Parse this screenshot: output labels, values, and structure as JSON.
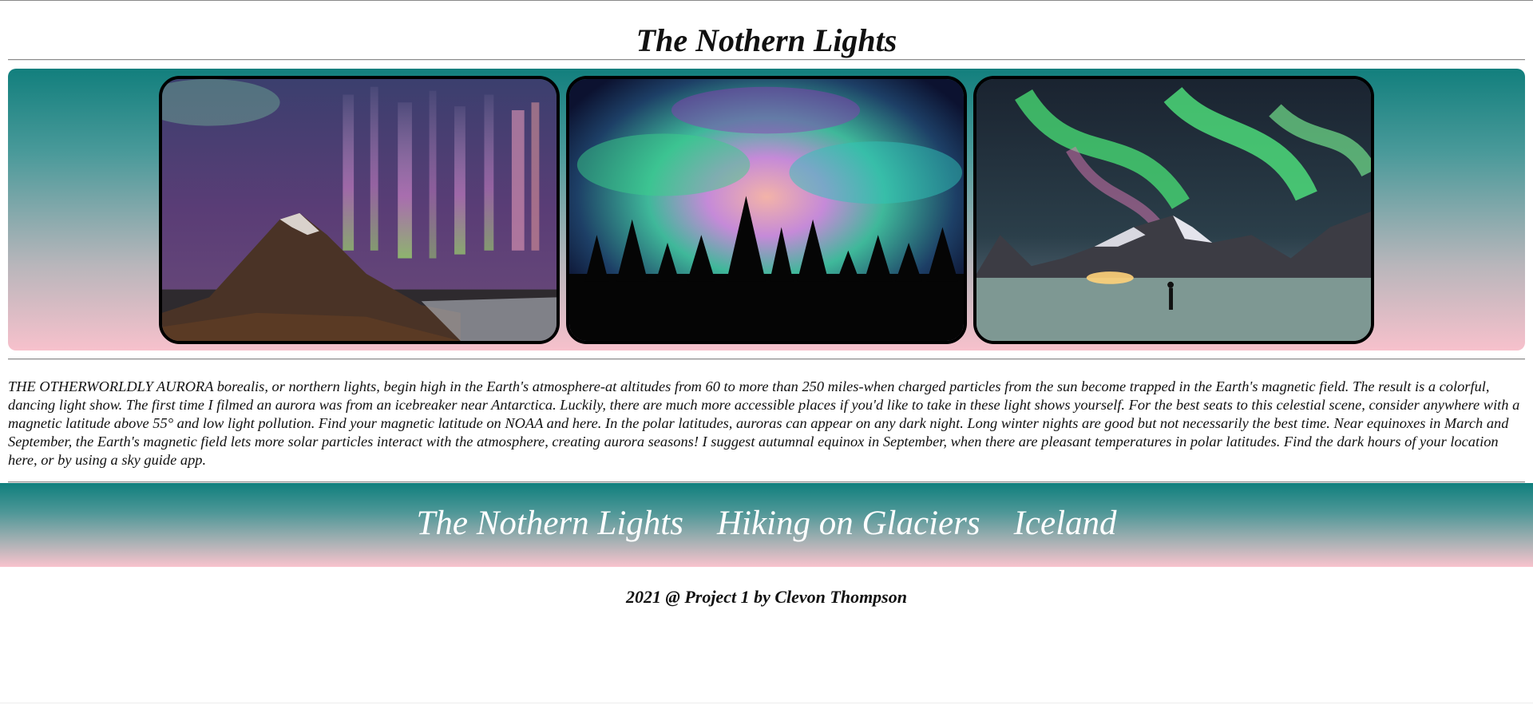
{
  "header": {
    "title": "The Nothern Lights"
  },
  "gallery": {
    "images": [
      {
        "name": "aurora-mountain-image"
      },
      {
        "name": "aurora-forest-image"
      },
      {
        "name": "aurora-glacier-image"
      }
    ],
    "colors": {
      "top": "#127f7d",
      "bottom": "#f7c1cc"
    }
  },
  "article": {
    "text": "THE OTHERWORLDLY AURORA borealis, or northern lights, begin high in the Earth's atmosphere-at altitudes from 60 to more than 250 miles-when charged particles from the sun become trapped in the Earth's magnetic field. The result is a colorful, dancing light show. The first time I filmed an aurora was from an icebreaker near Antarctica. Luckily, there are much more accessible places if you'd like to take in these light shows yourself. For the best seats to this celestial scene, consider anywhere with a magnetic latitude above 55° and low light pollution. Find your magnetic latitude on NOAA and here. In the polar latitudes, auroras can appear on any dark night. Long winter nights are good but not necessarily the best time. Near equinoxes in March and September, the Earth's magnetic field lets more solar particles interact with the atmosphere, creating aurora seasons! I suggest autumnal equinox in September, when there are pleasant temperatures in polar latitudes. Find the dark hours of your location here, or by using a sky guide app."
  },
  "nav": {
    "links": [
      {
        "label": "The Nothern Lights"
      },
      {
        "label": "Hiking on Glaciers"
      },
      {
        "label": "Iceland"
      }
    ]
  },
  "footer": {
    "text": "2021 @ Project 1 by Clevon Thompson"
  }
}
